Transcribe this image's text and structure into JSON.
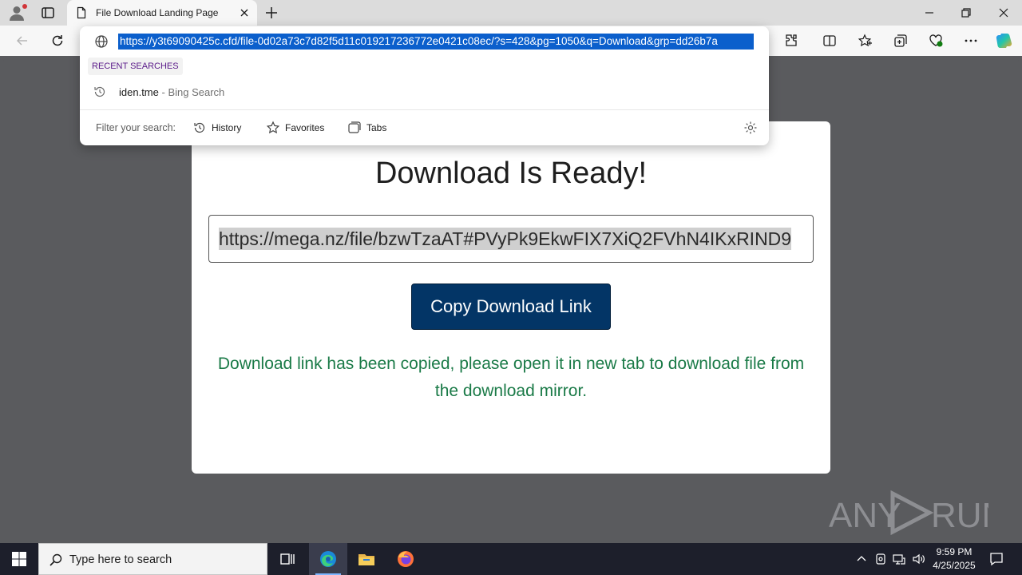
{
  "tab": {
    "title": "File Download Landing Page"
  },
  "address_bar": {
    "url": "https://y3t69090425c.cfd/file-0d02a73c7d82f5d11c019217236772e0421c08ec/?s=428&pg=1050&q=Download&grp=dd26b7a",
    "recent_label": "RECENT SEARCHES",
    "suggestion": {
      "text": "iden.tme",
      "separator": " - ",
      "source": "Bing Search"
    },
    "filter_label": "Filter your search:",
    "filters": [
      "History",
      "Favorites",
      "Tabs"
    ]
  },
  "page": {
    "heading": "Download Is Ready!",
    "link": "https://mega.nz/file/bzwTzaAT#PVyPk9EkwFIX7XiQ2FVhN4IKxRIND9",
    "button_label": "Copy Download Link",
    "message": "Download link has been copied, please open it in new tab to download file from the download mirror.",
    "colors": {
      "button": "#033566",
      "message": "#1a7a47"
    }
  },
  "watermark": {
    "text_left": "ANY",
    "text_right": "RUN"
  },
  "taskbar": {
    "search_placeholder": "Type here to search",
    "time": "9:59 PM",
    "date": "4/25/2025"
  }
}
